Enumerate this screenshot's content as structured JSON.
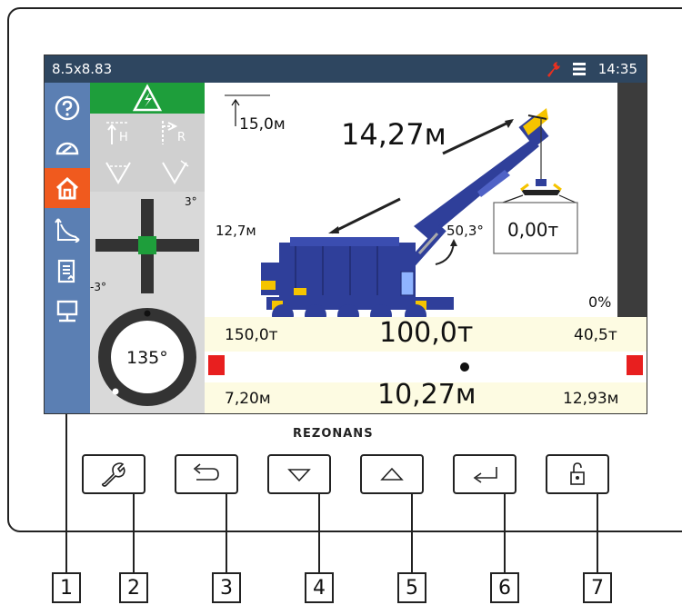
{
  "status_bar": {
    "title": "8.5x8.83",
    "time": "14:35"
  },
  "limits": {
    "h": "H",
    "r": "R"
  },
  "inclinometer": {
    "top_label": "3°",
    "bottom_label": "-3°"
  },
  "slew": {
    "angle": "135°"
  },
  "crane": {
    "height_value": "15,0м",
    "boom_length": "14,27м",
    "side_height": "12,7м",
    "boom_angle": "50,3°",
    "hook_load": "0,00т"
  },
  "load_percent": "0%",
  "info": {
    "max_load": "150,0т",
    "current_load": "100,0т",
    "rated_load": "40,5т",
    "min_radius": "7,20м",
    "current_radius": "10,27м",
    "max_radius": "12,93м"
  },
  "brand": "REZONANS",
  "callouts": [
    "1",
    "2",
    "3",
    "4",
    "5",
    "6",
    "7"
  ],
  "colors": {
    "status_bar": "#2e4660",
    "sidebar": "#5b7fb3",
    "active": "#f05a1e",
    "ok_green": "#1e9e3b",
    "crane_blue": "#2f3f9a",
    "warn_red": "#e81f1f"
  },
  "hardware_buttons": [
    "wrench-icon",
    "back-icon",
    "down-arrow-icon",
    "up-arrow-icon",
    "enter-icon",
    "unlock-icon"
  ]
}
